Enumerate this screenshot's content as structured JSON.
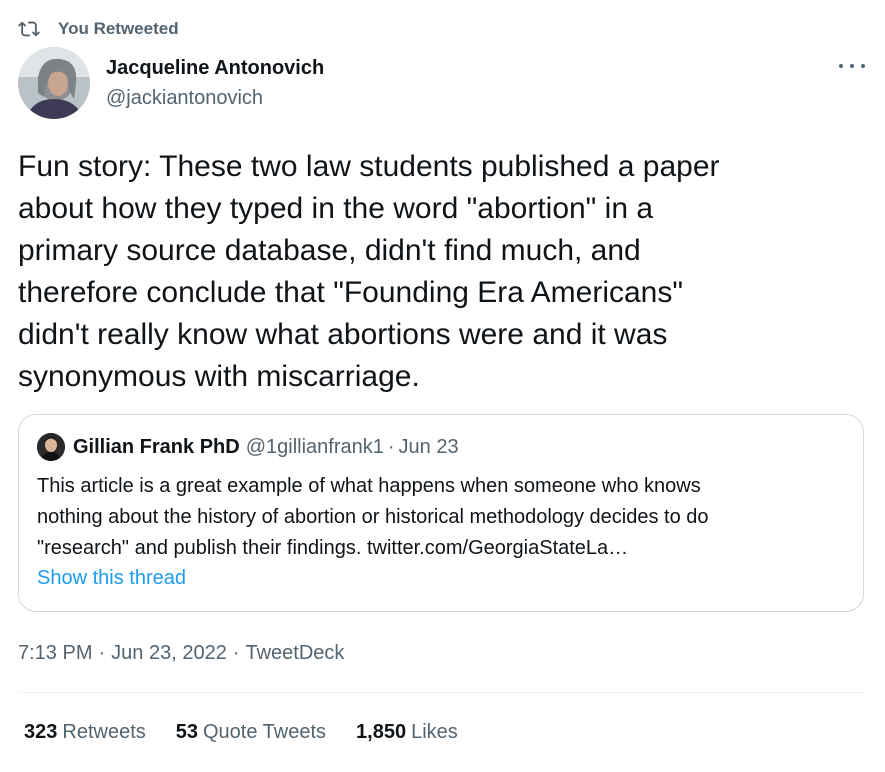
{
  "retweet_context": {
    "label": "You Retweeted",
    "icon": "retweet-icon"
  },
  "author": {
    "name": "Jacqueline Antonovich",
    "handle": "@jackiantonovich",
    "avatar": "profile-photo"
  },
  "more_icon": "more-options-icon",
  "tweet": {
    "text": "Fun story: These two law students published a paper\nabout how they typed in the word \"abortion\" in a\nprimary source database, didn't find much, and\ntherefore conclude that \"Founding Era Americans\"\ndidn't really know what abortions were and it was\nsynonymous with miscarriage."
  },
  "quote": {
    "name": "Gillian Frank PhD",
    "handle": "@1gillianfrank1",
    "separator": "·",
    "date": "Jun 23",
    "text": "This article is a great example of what happens when someone who knows\nnothing about the history of abortion or historical methodology decides to do\n\"research\" and publish their findings. twitter.com/GeorgiaStateLa…",
    "show_thread": "Show this thread"
  },
  "meta": {
    "time": "7:13 PM",
    "separator": "·",
    "date": "Jun 23, 2022",
    "source": "TweetDeck"
  },
  "stats": {
    "retweets": {
      "count": "323",
      "label": "Retweets"
    },
    "quote_tweets": {
      "count": "53",
      "label": "Quote Tweets"
    },
    "likes": {
      "count": "1,850",
      "label": "Likes"
    }
  },
  "colors": {
    "text_primary": "#0f1419",
    "text_secondary": "#536471",
    "link": "#1d9bf0",
    "border": "#cfd9de"
  }
}
